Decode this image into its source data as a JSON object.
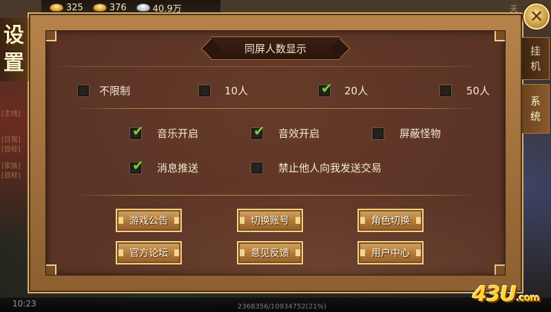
{
  "currency": {
    "gold": "325",
    "gold2": "376",
    "silver": "40.9万"
  },
  "top_right_text": "天",
  "side_title": [
    "设",
    "置"
  ],
  "background_labels": [
    "[主线]",
    "[日常]",
    "[目标]",
    "[家族]",
    "[目标]"
  ],
  "section_header": "同屏人数显示",
  "display_count_options": [
    {
      "label": "不限制",
      "checked": false
    },
    {
      "label": "10人",
      "checked": false
    },
    {
      "label": "20人",
      "checked": true
    },
    {
      "label": "50人",
      "checked": false
    }
  ],
  "toggles": [
    {
      "label": "音乐开启",
      "checked": true
    },
    {
      "label": "音效开启",
      "checked": true
    },
    {
      "label": "屏蔽怪物",
      "checked": false
    },
    {
      "label": "消息推送",
      "checked": true
    },
    {
      "label": "禁止他人向我发送交易",
      "checked": false
    }
  ],
  "buttons": {
    "announcement": "游戏公告",
    "switch_account": "切换账号",
    "switch_role": "角色切换",
    "forum": "官方论坛",
    "feedback": "意见反馈",
    "user_center": "用户中心"
  },
  "side_tabs": [
    {
      "label": [
        "挂",
        "机"
      ],
      "active": false
    },
    {
      "label": [
        "系",
        "统"
      ],
      "active": true
    }
  ],
  "close_symbol": "✕",
  "check_symbol": "✔",
  "clock": "10:23",
  "exp_text": "2368356/10934752(21%)",
  "watermark": {
    "main": "43U",
    "suffix": ".com"
  },
  "colors": {
    "check": "#7ad13a",
    "button_border": "#f3d58e",
    "panel_bg": "#5b3426"
  }
}
